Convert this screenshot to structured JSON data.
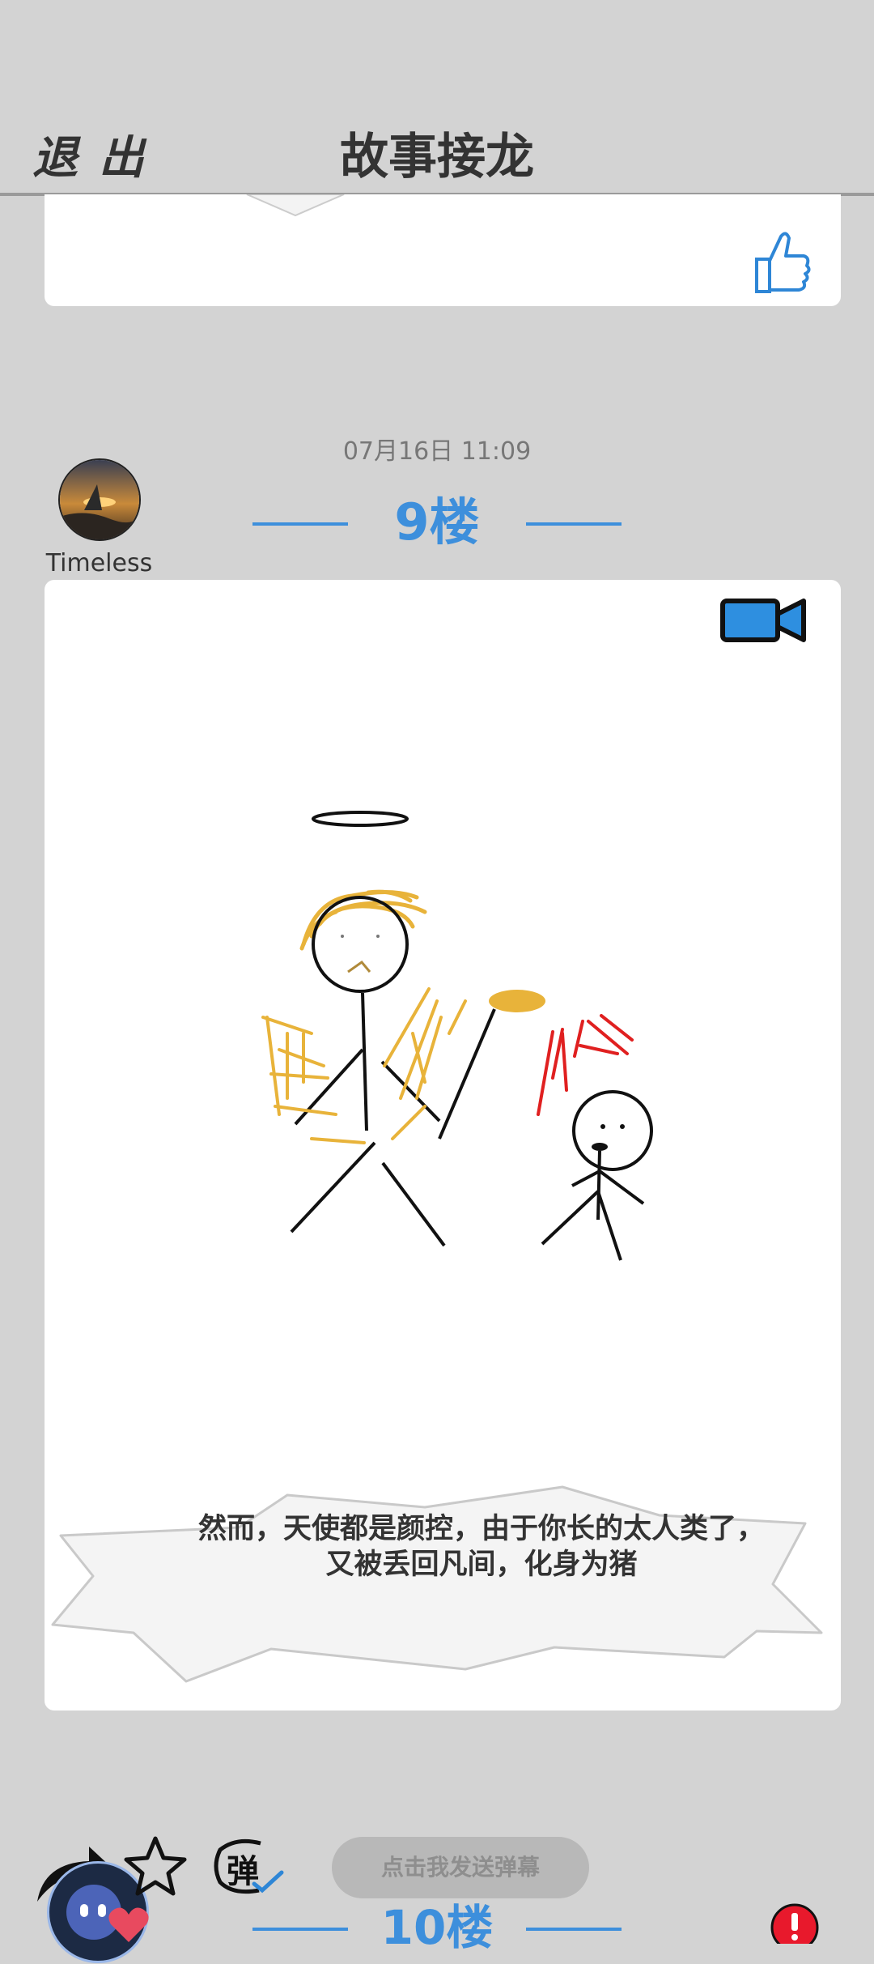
{
  "header": {
    "exit_label": "退出",
    "title": "故事接龙"
  },
  "post": {
    "timestamp": "07月16日  11:09",
    "floor": "9楼",
    "author": "Timeless",
    "caption_line1": "然而，天使都是颜控，由于你长的太人类了，",
    "caption_line2": "又被丢回凡间，化身为猪"
  },
  "next_post": {
    "floor": "10楼"
  },
  "bottom_bar": {
    "danmaku_placeholder": "点击我发送弹幕",
    "danmaku_icon_char": "弹"
  },
  "colors": {
    "accent_blue": "#3d8fdc",
    "background": "#d3d3d3",
    "card": "#ffffff"
  },
  "icons": [
    "thumbs-up-icon",
    "video-camera-icon",
    "share-icon",
    "star-icon",
    "danmaku-toggle-icon",
    "alert-icon"
  ]
}
